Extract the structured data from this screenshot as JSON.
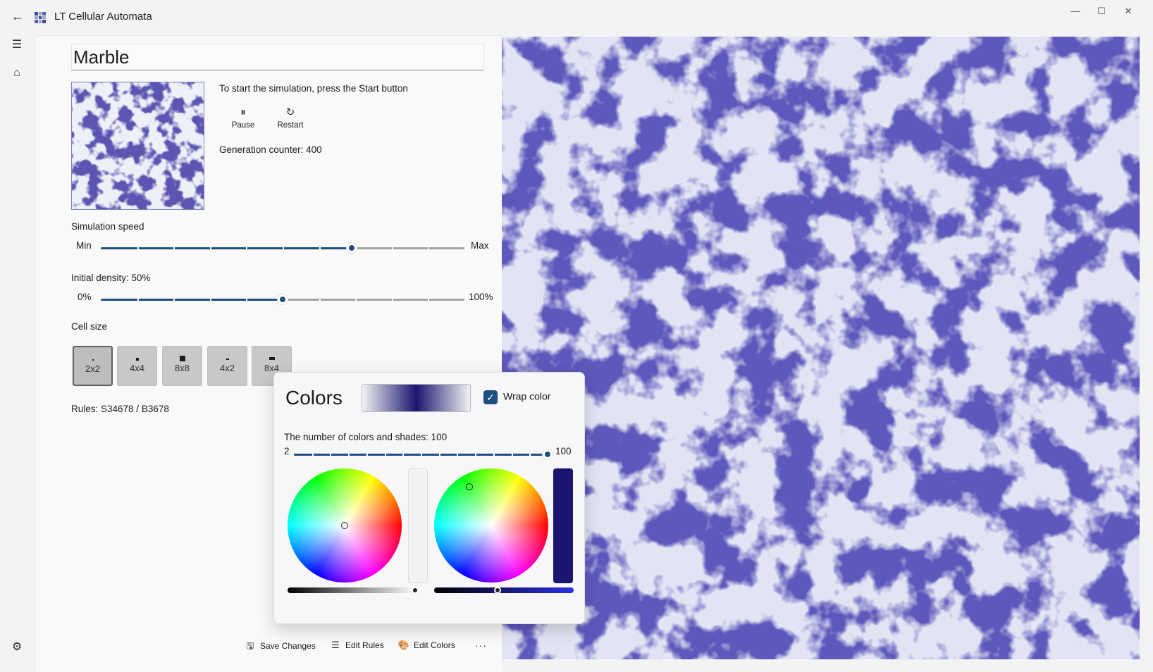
{
  "window": {
    "title": "LT Cellular Automata",
    "minimize": "—",
    "maximize": "☐",
    "close": "✕"
  },
  "nav": {
    "back_icon": "arrow-left-icon",
    "menu_icon": "hamburger-icon",
    "home_icon": "home-icon",
    "settings_icon": "gear-icon"
  },
  "automaton": {
    "name": "Marble",
    "hint": "To start the simulation, press the Start button",
    "pause_label": "Pause",
    "restart_label": "Restart",
    "generation_label": "Generation counter: 400",
    "rules": "Rules: S34678 / B3678"
  },
  "speed": {
    "label": "Simulation speed",
    "min_label": "Min",
    "max_label": "Max",
    "value_fraction": 0.69
  },
  "density": {
    "label": "Initial density: 50%",
    "min_label": "0%",
    "max_label": "100%",
    "value_fraction": 0.5
  },
  "cell_size": {
    "label": "Cell size",
    "options": [
      "2x2",
      "4x4",
      "8x8",
      "4x2",
      "8x4"
    ],
    "selected": "2x2"
  },
  "colors_flyout": {
    "title": "Colors",
    "wrap_label": "Wrap color",
    "wrap_checked": true,
    "count_label": "The number of colors and shades: 100",
    "count_min": "2",
    "count_max": "100",
    "count_value": 100,
    "color1_hex": "#f2f2f2",
    "color2_hex": "#1a1670"
  },
  "bottom_bar": {
    "save_label": "Save Changes",
    "edit_rules_label": "Edit Rules",
    "edit_colors_label": "Edit Colors",
    "more_label": "···"
  },
  "palette": {
    "accent": "#1c4f80",
    "marble_dark": "#1a1670",
    "marble_light": "#f2f2f8"
  }
}
